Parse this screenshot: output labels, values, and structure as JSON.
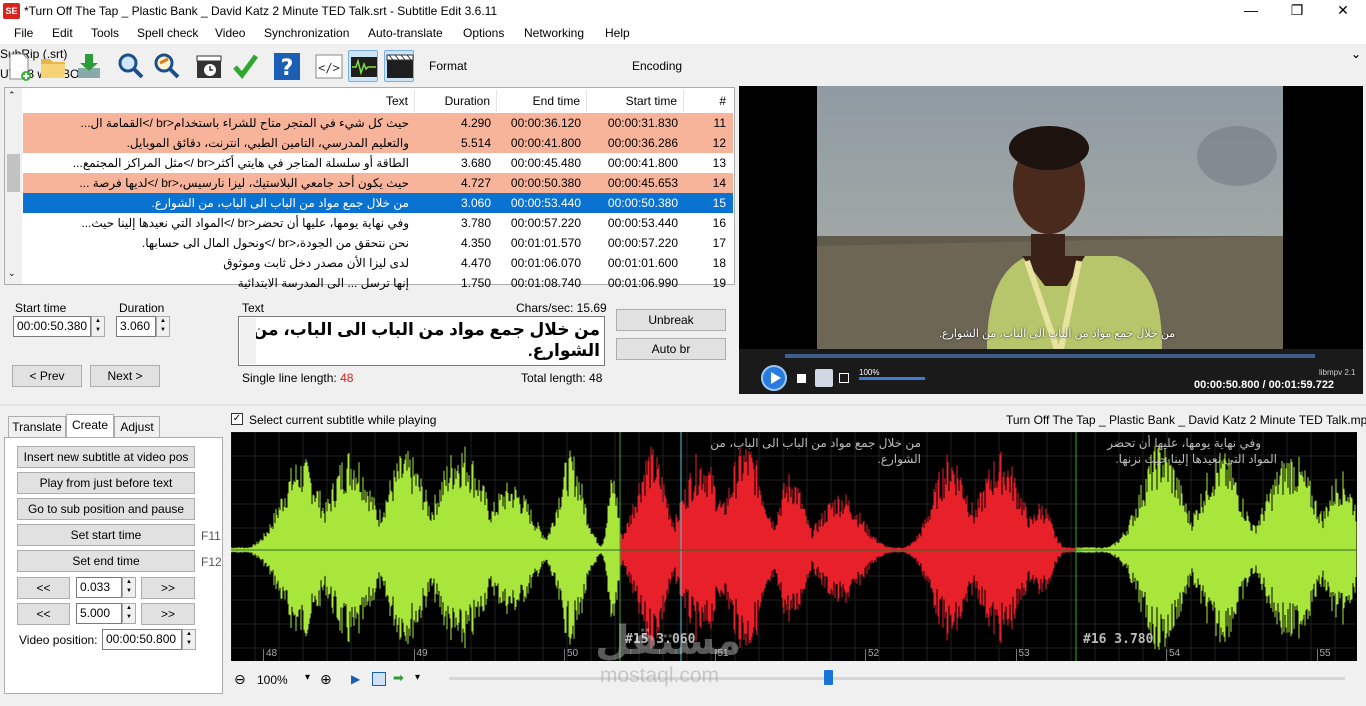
{
  "window": {
    "title": "*Turn Off The Tap  _ Plastic Bank _ David Katz 2 Minute TED Talk.srt - Subtitle Edit 3.6.11",
    "app_icon": "SE"
  },
  "menu": [
    "File",
    "Edit",
    "Tools",
    "Spell check",
    "Video",
    "Synchronization",
    "Auto-translate",
    "Options",
    "Networking",
    "Help"
  ],
  "toolbar": {
    "format_label": "Format",
    "format_value": "SubRip (.srt)",
    "encoding_label": "Encoding",
    "encoding_value": "UTF-8 with BOM"
  },
  "list": {
    "columns": {
      "num": "#",
      "start": "Start time",
      "end": "End time",
      "duration": "Duration",
      "text": "Text"
    },
    "rows": [
      {
        "num": "11",
        "start": "00:00:31.830",
        "end": "00:00:36.120",
        "duration": "4.290",
        "text": "حيث كل شيء في المتجر متاح للشراء باستخدام<br />القمامة ال...",
        "state": "err"
      },
      {
        "num": "12",
        "start": "00:00:36.286",
        "end": "00:00:41.800",
        "duration": "5.514",
        "text": "والتعليم المدرسي، التامين الطبي، انترنت، دقائق الموبايل.",
        "state": "err"
      },
      {
        "num": "13",
        "start": "00:00:41.800",
        "end": "00:00:45.480",
        "duration": "3.680",
        "text": "الطاقة أو سلسلة المتاجر في هايتي أكثر<br />مثل المراكز المجتمع...",
        "state": ""
      },
      {
        "num": "14",
        "start": "00:00:45.653",
        "end": "00:00:50.380",
        "duration": "4.727",
        "text": "حيث يكون أحد جامعي البلاستيك، ليزا نارسيس،<br />لديها فرصة ...",
        "state": "err"
      },
      {
        "num": "15",
        "start": "00:00:50.380",
        "end": "00:00:53.440",
        "duration": "3.060",
        "text": "من خلال جمع مواد من الباب الى الباب، من الشوارع.",
        "state": "sel"
      },
      {
        "num": "16",
        "start": "00:00:53.440",
        "end": "00:00:57.220",
        "duration": "3.780",
        "text": "وفي نهاية يومها، عليها أن تحضر<br />المواد التي نعيدها إلينا حيث...",
        "state": ""
      },
      {
        "num": "17",
        "start": "00:00:57.220",
        "end": "00:01:01.570",
        "duration": "4.350",
        "text": "نحن نتحقق من الجودة،<br />ونحول المال الى حسابها.",
        "state": ""
      },
      {
        "num": "18",
        "start": "00:01:01.600",
        "end": "00:01:06.070",
        "duration": "4.470",
        "text": "لدى ليزا الأن مصدر دخل ثابت وموثوق",
        "state": ""
      },
      {
        "num": "19",
        "start": "00:01:06.990",
        "end": "00:01:08.740",
        "duration": "1.750",
        "text": "إنها ترسل ... الى المدرسة الابتدائية",
        "state": ""
      }
    ]
  },
  "editor": {
    "start_label": "Start time",
    "start_value": "00:00:50.380",
    "duration_label": "Duration",
    "duration_value": "3.060",
    "text_label": "Text",
    "chars_sec": "Chars/sec: 15.69",
    "text_value": "من خلال جمع مواد من الباب الى الباب، من الشوارع.",
    "single_line_label": "Single line length: ",
    "single_line_value": "48",
    "total_length": "Total length: 48",
    "prev": "< Prev",
    "next": "Next >",
    "unbreak": "Unbreak",
    "auto_br": "Auto br"
  },
  "video": {
    "subtitle": "من خلال جمع مواد من الباب الى الباب، من الشوارع.",
    "volume": "100%",
    "engine": "libmpv 2.1",
    "position": "00:00:50.800 / 00:01:59.722"
  },
  "tabs": [
    "Translate",
    "Create",
    "Adjust"
  ],
  "create": {
    "insert": "Insert new subtitle at video pos",
    "play_before": "Play from just before text",
    "goto_pause": "Go to sub position and pause",
    "set_start": "Set start time",
    "f11": "F11",
    "set_end": "Set end time",
    "f12": "F12",
    "back": "<<",
    "fwd": ">>",
    "step1": "0.033",
    "step2": "5.000",
    "video_pos_label": "Video position:",
    "video_pos": "00:00:50.800"
  },
  "wave": {
    "select_while_playing": "Select current subtitle while playing",
    "filename": "Turn Off The Tap  _ Plastic Bank _ David Katz 2 Minute TED Talk.mp4",
    "sub1_text_1": "من خلال جمع مواد من الباب الى الباب، من",
    "sub1_text_2": "الشوارع.",
    "sub2_text_1": "وفي نهاية يومها، عليها أن تحضر",
    "sub2_text_2": "المواد التي نعيدها إلينا حيث نزنها.",
    "sub1_label": "#15  3.060",
    "sub2_label": "#16  3.780",
    "ticks": [
      "48",
      "49",
      "50",
      "51",
      "52",
      "53",
      "54",
      "55"
    ],
    "zoom": "100%"
  },
  "watermark": {
    "line1": "مستقل",
    "line2": "mostaql.com"
  },
  "colors": {
    "selection": "#0a72d0",
    "error_row": "#f7b49b",
    "wave_green": "#a8e63c",
    "wave_red": "#e8202a"
  }
}
